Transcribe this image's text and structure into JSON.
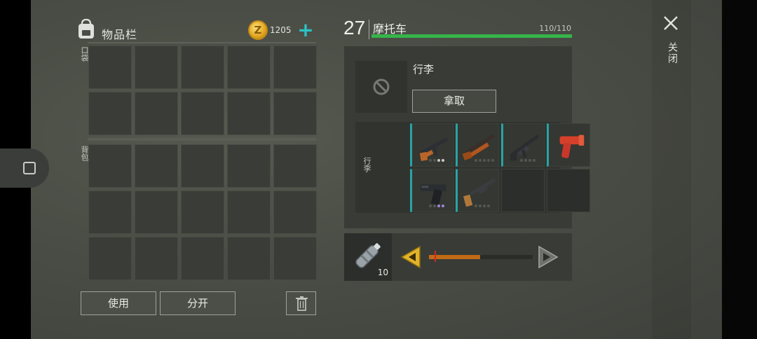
{
  "inventory": {
    "title": "物品栏",
    "coins": "1205",
    "pocket_label": "口袋",
    "backpack_label": "背包",
    "pocket_slots": 10,
    "backpack_slots": 15,
    "use_label": "使用",
    "split_label": "分开"
  },
  "vehicle": {
    "level": "27",
    "name": "摩托车",
    "hp_text": "110/110",
    "hp_fraction": 1.0,
    "luggage_title": "行李",
    "take_label": "拿取",
    "luggage_side_label": "行李",
    "items": [
      {
        "icon": "ak-rifle-icon",
        "dots": [
          "",
          "",
          "w",
          "w"
        ]
      },
      {
        "icon": "shotgun-icon",
        "dots": [
          "",
          "",
          "",
          "",
          ""
        ]
      },
      {
        "icon": "assault-rifle-icon",
        "dots": [
          "",
          "",
          "",
          ""
        ]
      },
      {
        "icon": "flare-gun-icon",
        "dots": []
      },
      {
        "icon": "pistol-icon",
        "dots": [
          "",
          "",
          "p",
          "p"
        ]
      },
      {
        "icon": "pump-shotgun-icon",
        "dots": [
          "",
          "",
          "",
          ""
        ]
      },
      {
        "icon": "",
        "dots": []
      },
      {
        "icon": "",
        "dots": []
      }
    ]
  },
  "consumable": {
    "icon": "water-bottle-icon",
    "quantity": "10",
    "slider_fraction": 0.49
  },
  "close_label": "关闭",
  "colors": {
    "accent": "#2bc2c6",
    "hp": "#35b54a",
    "slider": "#c16a16",
    "coin": "#e0a51e"
  }
}
